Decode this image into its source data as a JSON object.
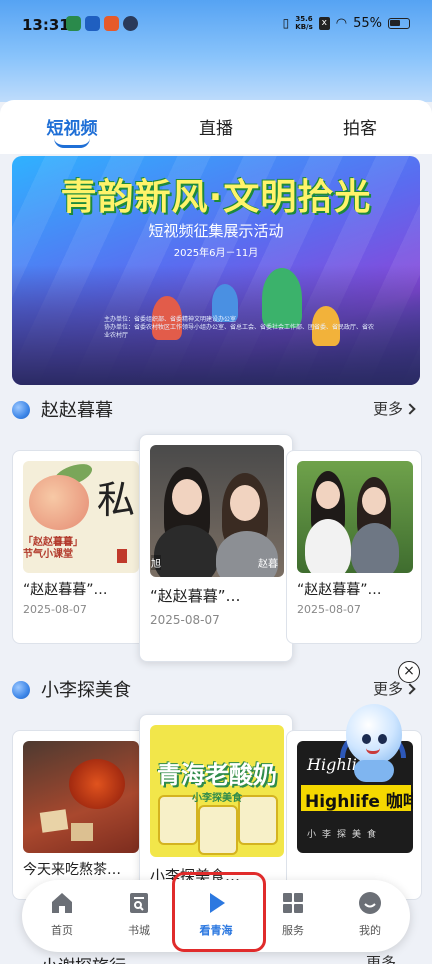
{
  "status_bar": {
    "time": "13:31",
    "net_speed_value": "35.6",
    "net_speed_unit": "KB/s",
    "battery": "55%"
  },
  "tabs": [
    {
      "label": "短视频",
      "active": true
    },
    {
      "label": "直播",
      "active": false
    },
    {
      "label": "拍客",
      "active": false
    }
  ],
  "banner": {
    "title": "青韵新风·文明拾光",
    "subtitle": "短视频征集展示活动",
    "date": "2025年6月－11月",
    "fine_print_1": "主办单位：省委组织部、省委精神文明建设办公室",
    "fine_print_2": "协办单位：省委农村牧区工作领导小组办公室、省总工会、省委社会工作部、团省委、省民政厅、省农业农村厅"
  },
  "sections": [
    {
      "title": "赵赵暮暮",
      "more": "更多",
      "cards": [
        {
          "title": "“赵赵暮暮”…",
          "date": "2025-08-07",
          "thumb_text_1": "「赵赵暮暮」",
          "thumb_text_2": "节气小课堂"
        },
        {
          "title": "“赵赵暮暮”…",
          "date": "2025-08-07",
          "thumb_tag_left": "旭",
          "thumb_tag_right": "赵暮"
        },
        {
          "title": "“赵赵暮暮”…",
          "date": "2025-08-07"
        }
      ]
    },
    {
      "title": "小李探美食",
      "more": "更多",
      "cards": [
        {
          "title": "今天来吃熬茶…",
          "date": ""
        },
        {
          "title": "小李探美食…",
          "date": "",
          "thumb_text_1": "青海老酸奶",
          "thumb_text_2": "小李探美食"
        },
        {
          "title": "",
          "date": "",
          "thumb_text_1": "Highlife",
          "thumb_text_2": "Highlife 咖啡",
          "thumb_text_3": "小李探美食"
        }
      ]
    },
    {
      "title": "小谢探旅行",
      "more": "更多"
    }
  ],
  "bottom_nav": [
    {
      "label": "首页",
      "icon": "home-icon",
      "active": false
    },
    {
      "label": "书城",
      "icon": "bookstore-icon",
      "active": false
    },
    {
      "label": "看青海",
      "icon": "play-icon",
      "active": true
    },
    {
      "label": "服务",
      "icon": "grid-icon",
      "active": false
    },
    {
      "label": "我的",
      "icon": "profile-icon",
      "active": false
    }
  ],
  "colors": {
    "accent": "#2c78e0",
    "highlight_box": "#e02b2b"
  }
}
